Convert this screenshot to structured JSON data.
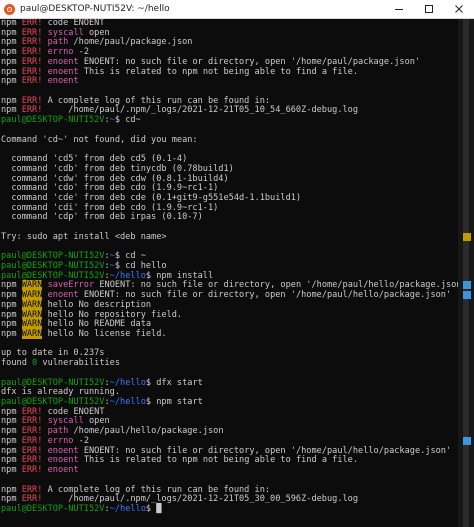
{
  "window": {
    "title": "paul@DESKTOP-NUTI52V: ~/hello",
    "controls": [
      "minimize",
      "maximize",
      "close"
    ]
  },
  "colors": {
    "background": "#0c0c0c",
    "text": "#cccccc",
    "err_red": "#e74856",
    "warn_yellow": "#c19c00",
    "magenta": "#d95fb3",
    "prompt_green": "#13a10e",
    "path_blue": "#3b78ff",
    "scroll_marker_cyan": "#3a96dd",
    "scroll_marker_yellow": "#c19c00"
  },
  "terminal": {
    "lines": [
      [
        {
          "t": "npm "
        },
        {
          "t": "ERR!",
          "c": "red"
        },
        {
          "t": " code ENOENT"
        }
      ],
      [
        {
          "t": "npm "
        },
        {
          "t": "ERR!",
          "c": "red"
        },
        {
          "t": " "
        },
        {
          "t": "syscall",
          "c": "magenta"
        },
        {
          "t": " open"
        }
      ],
      [
        {
          "t": "npm "
        },
        {
          "t": "ERR!",
          "c": "red"
        },
        {
          "t": " "
        },
        {
          "t": "path",
          "c": "magenta"
        },
        {
          "t": " /home/paul/package.json"
        }
      ],
      [
        {
          "t": "npm "
        },
        {
          "t": "ERR!",
          "c": "red"
        },
        {
          "t": " "
        },
        {
          "t": "errno",
          "c": "magenta"
        },
        {
          "t": " -2"
        }
      ],
      [
        {
          "t": "npm "
        },
        {
          "t": "ERR!",
          "c": "red"
        },
        {
          "t": " "
        },
        {
          "t": "enoent",
          "c": "magenta"
        },
        {
          "t": " ENOENT: no such file or directory, open '/home/paul/package.json'"
        }
      ],
      [
        {
          "t": "npm "
        },
        {
          "t": "ERR!",
          "c": "red"
        },
        {
          "t": " "
        },
        {
          "t": "enoent",
          "c": "magenta"
        },
        {
          "t": " This is related to npm not being able to find a file."
        }
      ],
      [
        {
          "t": "npm "
        },
        {
          "t": "ERR!",
          "c": "red"
        },
        {
          "t": " "
        },
        {
          "t": "enoent",
          "c": "magenta"
        }
      ],
      [
        {
          "t": ""
        }
      ],
      [
        {
          "t": "npm "
        },
        {
          "t": "ERR!",
          "c": "red"
        },
        {
          "t": " A complete log of this run can be found in:"
        }
      ],
      [
        {
          "t": "npm "
        },
        {
          "t": "ERR!",
          "c": "red"
        },
        {
          "t": "     /home/paul/.npm/_logs/2021-12-21T05_10_54_660Z-debug.log"
        }
      ],
      [
        {
          "t": "paul@DESKTOP-NUTI52V",
          "c": "green"
        },
        {
          "t": ":"
        },
        {
          "t": "~",
          "c": "blue"
        },
        {
          "t": "$ cd~"
        }
      ],
      [
        {
          "t": ""
        }
      ],
      [
        {
          "t": "Command 'cd~' not found, did you mean:"
        }
      ],
      [
        {
          "t": ""
        }
      ],
      [
        {
          "t": "  command 'cd5' from deb cd5 (0.1-4)"
        }
      ],
      [
        {
          "t": "  command 'cdb' from deb tinycdb (0.78build1)"
        }
      ],
      [
        {
          "t": "  command 'cdw' from deb cdw (0.8.1-1build4)"
        }
      ],
      [
        {
          "t": "  command 'cdo' from deb cdo (1.9.9~rc1-1)"
        }
      ],
      [
        {
          "t": "  command 'cde' from deb cde (0.1+git9-g551e54d-1.1build1)"
        }
      ],
      [
        {
          "t": "  command 'cdi' from deb cdo (1.9.9~rc1-1)"
        }
      ],
      [
        {
          "t": "  command 'cdp' from deb irpas (0.10-7)"
        }
      ],
      [
        {
          "t": ""
        }
      ],
      [
        {
          "t": "Try: sudo apt install <deb name>"
        }
      ],
      [
        {
          "t": ""
        }
      ],
      [
        {
          "t": "paul@DESKTOP-NUTI52V",
          "c": "green"
        },
        {
          "t": ":"
        },
        {
          "t": "~",
          "c": "blue"
        },
        {
          "t": "$ cd ~"
        }
      ],
      [
        {
          "t": "paul@DESKTOP-NUTI52V",
          "c": "green"
        },
        {
          "t": ":"
        },
        {
          "t": "~",
          "c": "blue"
        },
        {
          "t": "$ cd hello"
        }
      ],
      [
        {
          "t": "paul@DESKTOP-NUTI52V",
          "c": "green"
        },
        {
          "t": ":"
        },
        {
          "t": "~/hello",
          "c": "blue"
        },
        {
          "t": "$ npm install"
        }
      ],
      [
        {
          "t": "npm "
        },
        {
          "t": "WARN",
          "c": "warn"
        },
        {
          "t": " "
        },
        {
          "t": "saveError",
          "c": "magenta"
        },
        {
          "t": " ENOENT: no such file or directory, open '/home/paul/hello/package.json'"
        }
      ],
      [
        {
          "t": "npm "
        },
        {
          "t": "WARN",
          "c": "warn"
        },
        {
          "t": " "
        },
        {
          "t": "enoent",
          "c": "magenta"
        },
        {
          "t": " ENOENT: no such file or directory, open '/home/paul/hello/package.json'"
        }
      ],
      [
        {
          "t": "npm "
        },
        {
          "t": "WARN",
          "c": "warn"
        },
        {
          "t": " hello No description"
        }
      ],
      [
        {
          "t": "npm "
        },
        {
          "t": "WARN",
          "c": "warn"
        },
        {
          "t": " hello No repository field."
        }
      ],
      [
        {
          "t": "npm "
        },
        {
          "t": "WARN",
          "c": "warn"
        },
        {
          "t": " hello No README data"
        }
      ],
      [
        {
          "t": "npm "
        },
        {
          "t": "WARN",
          "c": "warn"
        },
        {
          "t": " hello No license field."
        }
      ],
      [
        {
          "t": ""
        }
      ],
      [
        {
          "t": "up to date in 0.237s"
        }
      ],
      [
        {
          "t": "found "
        },
        {
          "t": "0",
          "c": "green"
        },
        {
          "t": " vulnerabilities"
        }
      ],
      [
        {
          "t": ""
        }
      ],
      [
        {
          "t": "paul@DESKTOP-NUTI52V",
          "c": "green"
        },
        {
          "t": ":"
        },
        {
          "t": "~/hello",
          "c": "blue"
        },
        {
          "t": "$ dfx start"
        }
      ],
      [
        {
          "t": "dfx is already running."
        }
      ],
      [
        {
          "t": "paul@DESKTOP-NUTI52V",
          "c": "green"
        },
        {
          "t": ":"
        },
        {
          "t": "~/hello",
          "c": "blue"
        },
        {
          "t": "$ npm start"
        }
      ],
      [
        {
          "t": "npm "
        },
        {
          "t": "ERR!",
          "c": "red"
        },
        {
          "t": " code ENOENT"
        }
      ],
      [
        {
          "t": "npm "
        },
        {
          "t": "ERR!",
          "c": "red"
        },
        {
          "t": " "
        },
        {
          "t": "syscall",
          "c": "magenta"
        },
        {
          "t": " open"
        }
      ],
      [
        {
          "t": "npm "
        },
        {
          "t": "ERR!",
          "c": "red"
        },
        {
          "t": " "
        },
        {
          "t": "path",
          "c": "magenta"
        },
        {
          "t": " /home/paul/hello/package.json"
        }
      ],
      [
        {
          "t": "npm "
        },
        {
          "t": "ERR!",
          "c": "red"
        },
        {
          "t": " "
        },
        {
          "t": "errno",
          "c": "magenta"
        },
        {
          "t": " -2"
        }
      ],
      [
        {
          "t": "npm "
        },
        {
          "t": "ERR!",
          "c": "red"
        },
        {
          "t": " "
        },
        {
          "t": "enoent",
          "c": "magenta"
        },
        {
          "t": " ENOENT: no such file or directory, open '/home/paul/hello/package.json'"
        }
      ],
      [
        {
          "t": "npm "
        },
        {
          "t": "ERR!",
          "c": "red"
        },
        {
          "t": " "
        },
        {
          "t": "enoent",
          "c": "magenta"
        },
        {
          "t": " This is related to npm not being able to find a file."
        }
      ],
      [
        {
          "t": "npm "
        },
        {
          "t": "ERR!",
          "c": "red"
        },
        {
          "t": " "
        },
        {
          "t": "enoent",
          "c": "magenta"
        }
      ],
      [
        {
          "t": ""
        }
      ],
      [
        {
          "t": "npm "
        },
        {
          "t": "ERR!",
          "c": "red"
        },
        {
          "t": " A complete log of this run can be found in:"
        }
      ],
      [
        {
          "t": "npm "
        },
        {
          "t": "ERR!",
          "c": "red"
        },
        {
          "t": "     /home/paul/.npm/_logs/2021-12-21T05_30_00_596Z-debug.log"
        }
      ],
      [
        {
          "t": "paul@DESKTOP-NUTI52V",
          "c": "green"
        },
        {
          "t": ":"
        },
        {
          "t": "~/hello",
          "c": "blue"
        },
        {
          "t": "$ "
        },
        {
          "t": "█",
          "c": "cursor"
        }
      ]
    ]
  },
  "scrollbar": {
    "markers": [
      {
        "color": "scroll_marker_yellow",
        "line": 22
      },
      {
        "color": "scroll_marker_cyan",
        "line": 27
      },
      {
        "color": "scroll_marker_cyan",
        "line": 28
      },
      {
        "color": "scroll_marker_cyan",
        "line": 43
      }
    ]
  }
}
